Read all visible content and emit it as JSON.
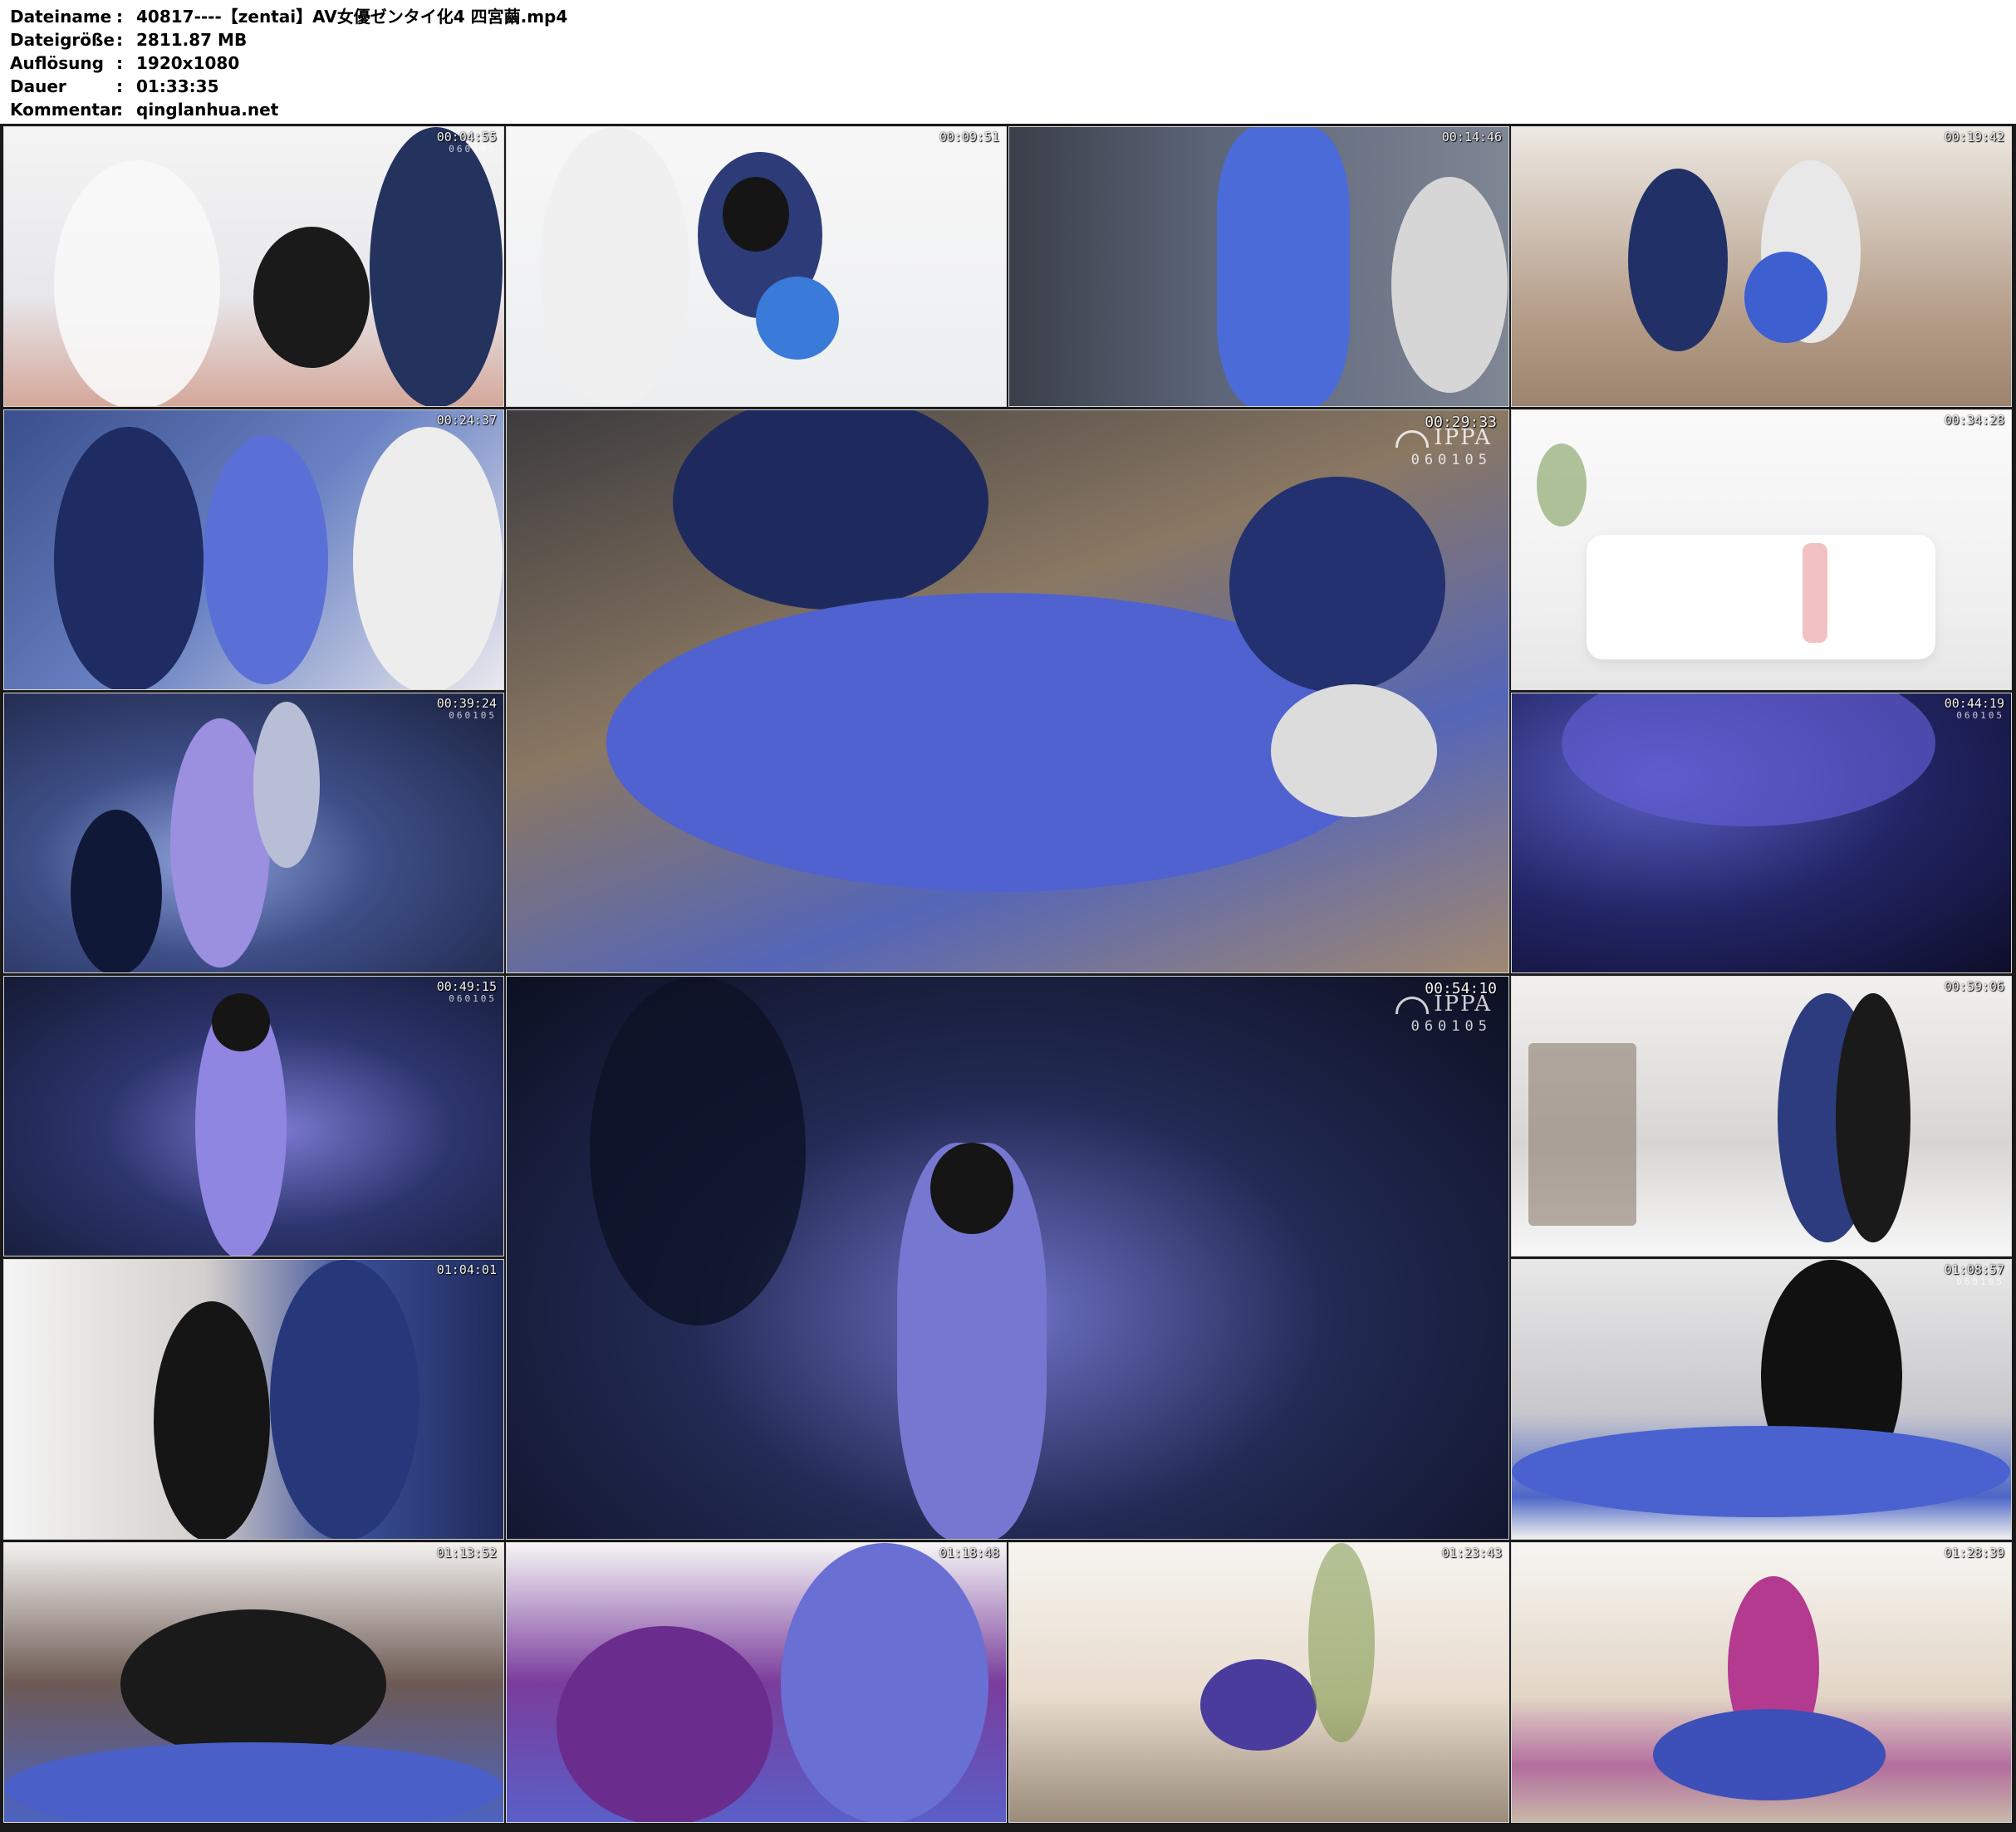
{
  "info": {
    "rows": [
      {
        "label": "Dateiname",
        "sep": ":",
        "value": "40817----【zentai】AV女優ゼンタイ化4 四宮繭.mp4"
      },
      {
        "label": "Dateigröße",
        "sep": ":",
        "value": "2811.87 MB"
      },
      {
        "label": "Auflösung",
        "sep": ":",
        "value": "1920x1080"
      },
      {
        "label": "Dauer",
        "sep": ":",
        "value": "01:33:35"
      },
      {
        "label": "Kommentar",
        "sep": ":",
        "value": "qinglanhua.net"
      }
    ]
  },
  "thumbnails": [
    {
      "timestamp": "00:04:55",
      "watermark": "060105"
    },
    {
      "timestamp": "00:09:51",
      "watermark": ""
    },
    {
      "timestamp": "00:14:46",
      "watermark": ""
    },
    {
      "timestamp": "00:19:42",
      "watermark": ""
    },
    {
      "timestamp": "00:24:37",
      "watermark": ""
    },
    {
      "timestamp": "00:29:33",
      "watermark": "060105",
      "logo": "IPPA"
    },
    {
      "timestamp": "00:34:28",
      "watermark": ""
    },
    {
      "timestamp": "00:39:24",
      "watermark": "060105"
    },
    {
      "timestamp": "00:44:19",
      "watermark": "060105"
    },
    {
      "timestamp": "00:49:15",
      "watermark": "060105"
    },
    {
      "timestamp": "00:54:10",
      "watermark": "060105",
      "logo": "IPPA"
    },
    {
      "timestamp": "00:59:06",
      "watermark": ""
    },
    {
      "timestamp": "01:04:01",
      "watermark": ""
    },
    {
      "timestamp": "01:08:57",
      "watermark": "060105"
    },
    {
      "timestamp": "01:13:52",
      "watermark": ""
    },
    {
      "timestamp": "01:18:48",
      "watermark": ""
    },
    {
      "timestamp": "01:23:43",
      "watermark": ""
    },
    {
      "timestamp": "01:28:39",
      "watermark": ""
    }
  ]
}
